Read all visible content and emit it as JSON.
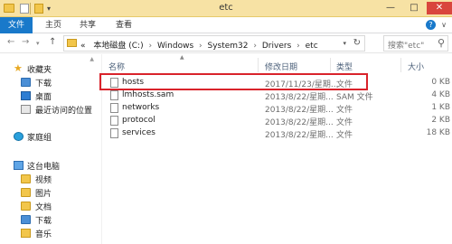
{
  "window": {
    "title": "etc",
    "minimize": "—",
    "maximize": "□",
    "close": "✕"
  },
  "ribbon": {
    "tabs": [
      "文件",
      "主页",
      "共享",
      "查看"
    ],
    "expand": "∨",
    "help": "?"
  },
  "address": {
    "back": "←",
    "forward": "→",
    "up": "↑",
    "breadcrumbs": [
      "本地磁盘 (C:)",
      "Windows",
      "System32",
      "Drivers",
      "etc"
    ],
    "prefix": "«",
    "separator": "›",
    "search_placeholder": "搜索\"etc\""
  },
  "nav": {
    "items": [
      {
        "label": "收藏夹",
        "icon": "star-icon"
      },
      {
        "label": "下载",
        "icon": "download-folder-icon"
      },
      {
        "label": "桌面",
        "icon": "desktop-icon"
      },
      {
        "label": "最近访问的位置",
        "icon": "recent-places-icon"
      },
      {
        "label": "家庭组",
        "icon": "homegroup-icon"
      },
      {
        "label": "这台电脑",
        "icon": "this-pc-icon"
      },
      {
        "label": "视频",
        "icon": "videos-folder-icon"
      },
      {
        "label": "图片",
        "icon": "pictures-folder-icon"
      },
      {
        "label": "文档",
        "icon": "documents-folder-icon"
      },
      {
        "label": "下载",
        "icon": "download-folder-icon"
      },
      {
        "label": "音乐",
        "icon": "music-folder-icon"
      }
    ]
  },
  "files": {
    "columns": [
      "名称",
      "修改日期",
      "类型",
      "大小"
    ],
    "rows": [
      {
        "name": "hosts",
        "date": "2017/11/23/星期...",
        "type": "文件",
        "size": "0 KB"
      },
      {
        "name": "lmhosts.sam",
        "date": "2013/8/22/星期...",
        "type": "SAM 文件",
        "size": "4 KB"
      },
      {
        "name": "networks",
        "date": "2013/8/22/星期...",
        "type": "文件",
        "size": "1 KB"
      },
      {
        "name": "protocol",
        "date": "2013/8/22/星期...",
        "type": "文件",
        "size": "2 KB"
      },
      {
        "name": "services",
        "date": "2013/8/22/星期...",
        "type": "文件",
        "size": "18 KB"
      }
    ],
    "highlight_color": "#d9232b"
  },
  "colors": {
    "titlebar": "#f7e2a4",
    "file_tab": "#1979ca",
    "close_button": "#d9463d"
  }
}
